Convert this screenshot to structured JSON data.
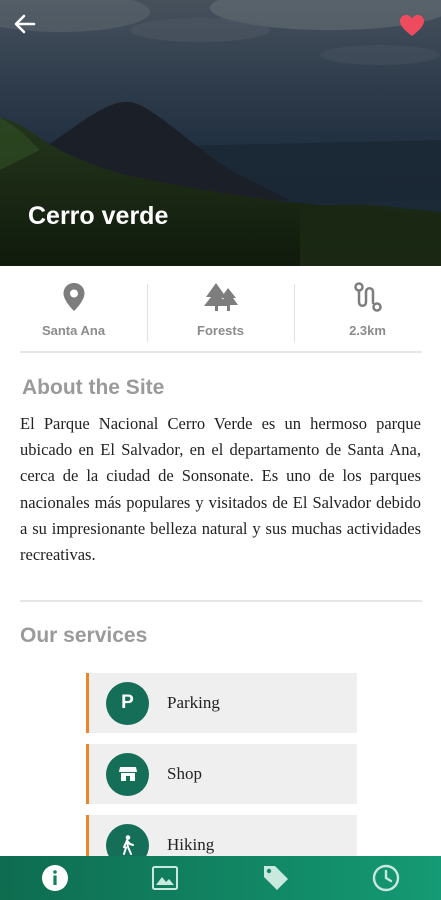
{
  "header": {
    "title": "Cerro verde",
    "back_icon": "arrow-left-icon",
    "favorite_icon": "heart-icon",
    "favorite_color": "#ef4b5f"
  },
  "info": [
    {
      "icon": "location-pin-icon",
      "label": "Santa Ana"
    },
    {
      "icon": "trees-icon",
      "label": "Forests"
    },
    {
      "icon": "route-icon",
      "label": "2.3km"
    }
  ],
  "about": {
    "title": "About the Site",
    "text": "El Parque Nacional Cerro Verde es un hermoso parque ubicado en El Salvador, en el departamento de Santa Ana, cerca de la ciudad de Sonsonate. Es uno de los parques nacionales más populares y visitados de El Salvador debido a su impresionante belleza natural y sus muchas actividades recreativas."
  },
  "services": {
    "title": "Our services",
    "items": [
      {
        "icon": "parking-icon",
        "glyph": "P",
        "label": "Parking"
      },
      {
        "icon": "shop-icon",
        "label": "Shop"
      },
      {
        "icon": "hiking-icon",
        "label": "Hiking"
      }
    ]
  },
  "bottom_nav": [
    {
      "icon": "info-icon",
      "active": true
    },
    {
      "icon": "image-icon",
      "active": false
    },
    {
      "icon": "tag-icon",
      "active": false
    },
    {
      "icon": "clock-icon",
      "active": false
    }
  ],
  "colors": {
    "accent_green": "#146e58",
    "service_border": "#e8862a",
    "nav_gradient_start": "#0e6c4f",
    "nav_gradient_end": "#149a74"
  }
}
